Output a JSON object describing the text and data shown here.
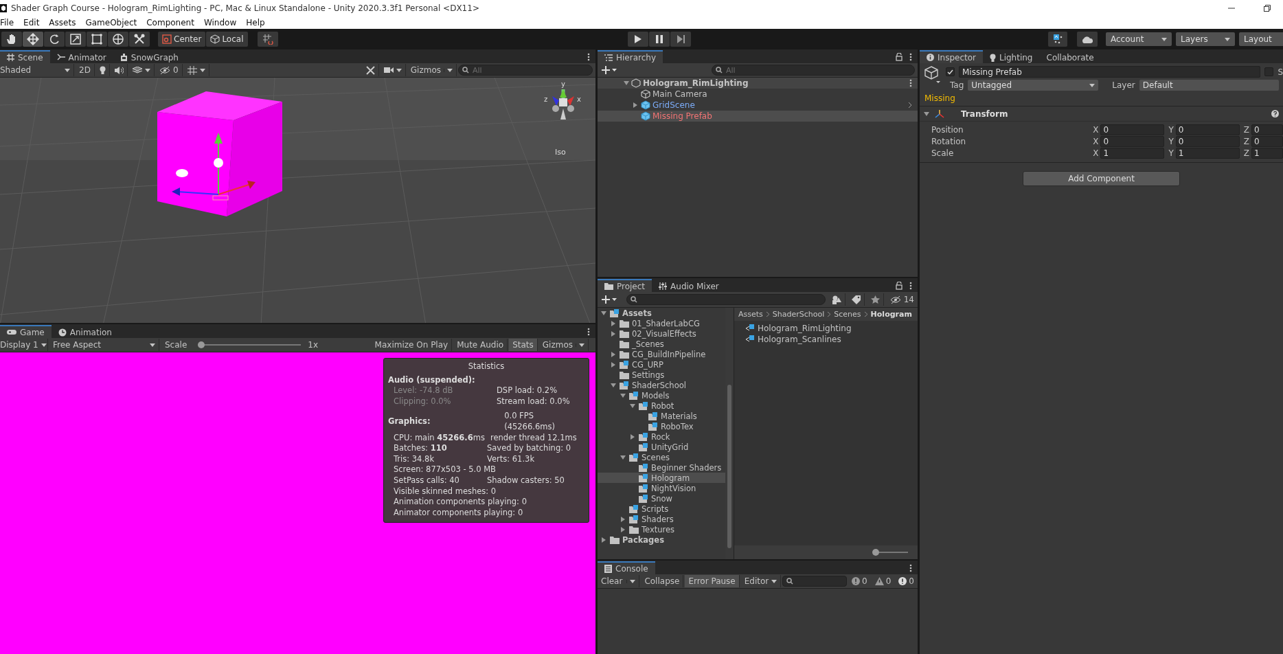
{
  "window": {
    "title": "Shader Graph Course - Hologram_RimLighting - PC, Mac & Linux Standalone - Unity 2020.3.3f1 Personal <DX11>"
  },
  "menu": [
    "File",
    "Edit",
    "Assets",
    "GameObject",
    "Component",
    "Window",
    "Help"
  ],
  "toolbar": {
    "tools": [
      {
        "kind": "hand",
        "selected": false
      },
      {
        "kind": "move",
        "selected": true
      },
      {
        "kind": "rotate",
        "selected": false
      },
      {
        "kind": "scale",
        "selected": false
      },
      {
        "kind": "rect",
        "selected": false
      },
      {
        "kind": "transform",
        "selected": false
      },
      {
        "kind": "custom",
        "selected": false
      }
    ],
    "pivot": "Center",
    "space": "Local",
    "account": "Account",
    "layers": "Layers",
    "layout": "Layout"
  },
  "scene": {
    "tabs": [
      {
        "label": "Scene",
        "kind": "scene",
        "selected": true
      },
      {
        "label": "Animator",
        "kind": "animator",
        "selected": false
      },
      {
        "label": "SnowGraph",
        "kind": "graph",
        "selected": false
      }
    ],
    "shading": "Shaded",
    "mode_2d": "2D",
    "hidden_count": "0",
    "gizmos": "Gizmos",
    "search_placeholder": "All",
    "axes": [
      "y",
      "z",
      "x"
    ],
    "projection": "Iso"
  },
  "game": {
    "tabs": [
      {
        "label": "Game",
        "kind": "game",
        "selected": true
      },
      {
        "label": "Animation",
        "kind": "animation",
        "selected": false
      }
    ],
    "display": "Display 1",
    "aspect": "Free Aspect",
    "scale_label": "Scale",
    "scale": {
      "level": 0.0
    },
    "scale_reading": "1x",
    "buttons": [
      {
        "label": "Maximize On Play",
        "on": false
      },
      {
        "label": "Mute Audio",
        "on": false
      },
      {
        "label": "Stats",
        "on": true
      }
    ],
    "gizmos": "Gizmos"
  },
  "statistics": {
    "title": "Statistics",
    "audio_heading": "Audio (suspended):",
    "audio_lines": [
      {
        "left": "Level: -74.8 dB",
        "right": "DSP load: 0.2%"
      },
      {
        "left": "Clipping: 0.0%",
        "right": "Stream load: 0.0%"
      }
    ],
    "graphics_heading": "Graphics:",
    "fps": "0.0 FPS (45266.6ms)",
    "graphics_lines": [
      {
        "left": "CPU: main **45266.6**ms",
        "right": "render thread 12.1ms"
      },
      {
        "left": "Batches: **110**",
        "right": "Saved by batching: 0"
      },
      {
        "left": "Tris: 34.8k",
        "right": "Verts: 61.3k"
      },
      {
        "left": "Screen: 877x503 - 5.0 MB"
      },
      {
        "left": "SetPass calls: 40",
        "right": "Shadow casters: 50"
      },
      {
        "left": "Visible skinned meshes: 0"
      },
      {
        "left": "Animation components playing: 0"
      },
      {
        "left": "Animator components playing: 0"
      }
    ]
  },
  "hierarchy": {
    "tab": "Hierarchy",
    "search_placeholder": "All",
    "scene": "Hologram_RimLighting",
    "items": [
      {
        "label": "Main Camera",
        "kind": "object",
        "selected": false
      },
      {
        "label": "GridScene",
        "kind": "prefab",
        "expanded": false,
        "selected": false
      },
      {
        "label": "Missing Prefab",
        "kind": "missing",
        "selected": true
      }
    ]
  },
  "project": {
    "tabs": [
      {
        "label": "Project",
        "kind": "folder",
        "selected": true
      },
      {
        "label": "Audio Mixer",
        "kind": "mixer",
        "selected": false
      }
    ],
    "hidden_count": "14",
    "tree": [
      {
        "label": "Assets",
        "kind": "package",
        "expanded": true,
        "selected": false,
        "children": [
          {
            "label": "01_ShaderLabCG",
            "kind": "folder",
            "expanded": false,
            "selected": false
          },
          {
            "label": "02_VisualEffects",
            "kind": "folder",
            "expanded": false,
            "selected": false
          },
          {
            "label": "_Scenes",
            "kind": "folder",
            "selected": false
          },
          {
            "label": "CG_BuildInPipeline",
            "kind": "folder",
            "expanded": false,
            "selected": false
          },
          {
            "label": "CG_URP",
            "kind": "package",
            "expanded": false,
            "selected": false
          },
          {
            "label": "Settings",
            "kind": "folder",
            "selected": false
          },
          {
            "label": "ShaderSchool",
            "kind": "package",
            "expanded": true,
            "selected": false,
            "children": [
              {
                "label": "Models",
                "kind": "package",
                "expanded": true,
                "selected": false,
                "children": [
                  {
                    "label": "Robot",
                    "kind": "package",
                    "expanded": true,
                    "selected": false,
                    "children": [
                      {
                        "label": "Materials",
                        "kind": "package",
                        "selected": false
                      },
                      {
                        "label": "RoboTex",
                        "kind": "package",
                        "selected": false
                      }
                    ]
                  },
                  {
                    "label": "Rock",
                    "kind": "package",
                    "expanded": false,
                    "selected": false
                  },
                  {
                    "label": "UnityGrid",
                    "kind": "package",
                    "selected": false
                  }
                ]
              },
              {
                "label": "Scenes",
                "kind": "package",
                "expanded": true,
                "selected": false,
                "children": [
                  {
                    "label": "Beginner Shaders",
                    "kind": "package",
                    "selected": false
                  },
                  {
                    "label": "Hologram",
                    "kind": "package",
                    "selected": true
                  },
                  {
                    "label": "NightVision",
                    "kind": "package",
                    "selected": false
                  },
                  {
                    "label": "Snow",
                    "kind": "package",
                    "selected": false
                  }
                ]
              },
              {
                "label": "Scripts",
                "kind": "package",
                "selected": false
              },
              {
                "label": "Shaders",
                "kind": "package",
                "expanded": false,
                "selected": false
              },
              {
                "label": "Textures",
                "kind": "folder",
                "expanded": false,
                "selected": false
              }
            ]
          }
        ]
      },
      {
        "label": "Packages",
        "kind": "folder",
        "expanded": false,
        "selected": false
      }
    ],
    "breadcrumb": [
      "Assets",
      "ShaderSchool",
      "Scenes",
      "Hologram"
    ],
    "files": [
      "Hologram_RimLighting",
      "Hologram_Scanlines"
    ],
    "zoom": {
      "level": 0.05
    }
  },
  "console": {
    "tab": "Console",
    "buttons": [
      {
        "label": "Clear",
        "on": false
      },
      {
        "label": "Collapse",
        "on": false
      },
      {
        "label": "Error Pause",
        "on": true
      }
    ],
    "editor": "Editor",
    "counts": [
      {
        "kind": "info",
        "count": "0"
      },
      {
        "kind": "warning",
        "count": "0"
      },
      {
        "kind": "error",
        "count": "0"
      }
    ]
  },
  "inspector": {
    "tabs": [
      {
        "label": "Inspector",
        "kind": "info",
        "selected": true
      },
      {
        "label": "Lighting",
        "kind": "light",
        "selected": false
      },
      {
        "label": "Collaborate",
        "kind": "none",
        "selected": false
      }
    ],
    "active": true,
    "name": "Missing Prefab",
    "static": false,
    "static_label": "S",
    "tag_label": "Tag",
    "tag": "Untagged",
    "layer_label": "Layer",
    "layer": "Default",
    "warning": "Missing",
    "component": {
      "title": "Transform",
      "expanded": true,
      "rows": [
        {
          "label": "Position",
          "values": [
            {
              "axis": "X",
              "value": "0"
            },
            {
              "axis": "Y",
              "value": "0"
            },
            {
              "axis": "Z",
              "value": "0"
            }
          ]
        },
        {
          "label": "Rotation",
          "values": [
            {
              "axis": "X",
              "value": "0"
            },
            {
              "axis": "Y",
              "value": "0"
            },
            {
              "axis": "Z",
              "value": "0"
            }
          ]
        },
        {
          "label": "Scale",
          "values": [
            {
              "axis": "X",
              "value": "1"
            },
            {
              "axis": "Y",
              "value": "1"
            },
            {
              "axis": "Z",
              "value": "1"
            }
          ]
        }
      ]
    },
    "add_button": "Add Component"
  }
}
